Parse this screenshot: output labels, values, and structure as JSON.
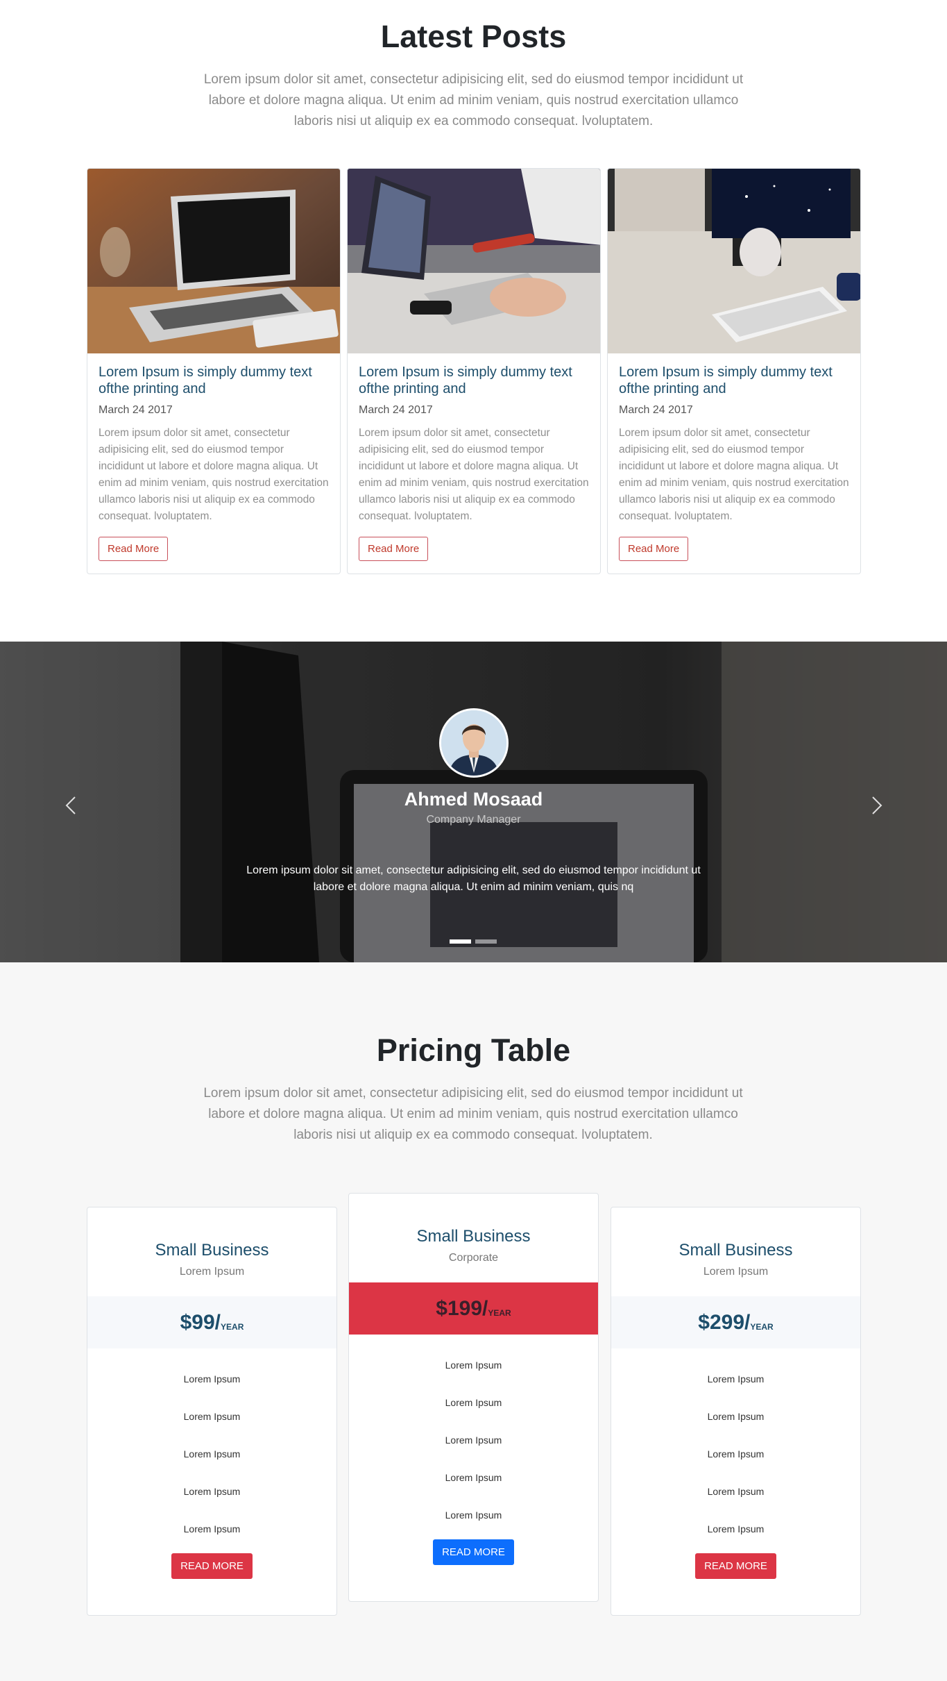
{
  "latest_posts": {
    "title": "Latest Posts",
    "intro": "Lorem ipsum dolor sit amet, consectetur adipisicing elit, sed do eiusmod tempor incididunt ut labore et dolore magna aliqua. Ut enim ad minim veniam, quis nostrud exercitation ullamco laboris nisi ut aliquip ex ea commodo consequat. lvoluptatem.",
    "posts": [
      {
        "image": "laptop-photo",
        "title": "Lorem Ipsum is simply dummy text ofthe printing and",
        "date": "March 24 2017",
        "text": "Lorem ipsum dolor sit amet, consectetur adipisicing elit, sed do eiusmod tempor incididunt ut labore et dolore magna aliqua. Ut enim ad minim veniam, quis nostrud exercitation ullamco laboris nisi ut aliquip ex ea commodo consequat. lvoluptatem.",
        "button": "Read More"
      },
      {
        "image": "desk-laptops-photo",
        "title": "Lorem Ipsum is simply dummy text ofthe printing and",
        "date": "March 24 2017",
        "text": "Lorem ipsum dolor sit amet, consectetur adipisicing elit, sed do eiusmod tempor incididunt ut labore et dolore magna aliqua. Ut enim ad minim veniam, quis nostrud exercitation ullamco laboris nisi ut aliquip ex ea commodo consequat. lvoluptatem.",
        "button": "Read More"
      },
      {
        "image": "workstation-photo",
        "title": "Lorem Ipsum is simply dummy text ofthe printing and",
        "date": "March 24 2017",
        "text": "Lorem ipsum dolor sit amet, consectetur adipisicing elit, sed do eiusmod tempor incididunt ut labore et dolore magna aliqua. Ut enim ad minim veniam, quis nostrud exercitation ullamco laboris nisi ut aliquip ex ea commodo consequat. lvoluptatem.",
        "button": "Read More"
      }
    ]
  },
  "testimonial": {
    "name": "Ahmed Mosaad",
    "role": "Company Manager",
    "quote": "Lorem ipsum dolor sit amet, consectetur adipisicing elit, sed do eiusmod tempor incididunt ut labore et dolore magna aliqua. Ut enim ad minim veniam, quis nq",
    "prev_icon": "chevron-left-icon",
    "next_icon": "chevron-right-icon",
    "slides_count": 2,
    "active_slide": 1
  },
  "pricing": {
    "title": "Pricing Table",
    "intro": "Lorem ipsum dolor sit amet, consectetur adipisicing elit, sed do eiusmod tempor incididunt ut labore et dolore magna aliqua. Ut enim ad minim veniam, quis nostrud exercitation ullamco laboris nisi ut aliquip ex ea commodo consequat. lvoluptatem.",
    "plans": [
      {
        "title": "Small Business",
        "subtitle": "Lorem Ipsum",
        "price": "$99/",
        "period": "YEAR",
        "features": [
          "Lorem Ipsum",
          "Lorem Ipsum",
          "Lorem Ipsum",
          "Lorem Ipsum",
          "Lorem Ipsum"
        ],
        "button": "READ MORE"
      },
      {
        "title": "Small Business",
        "subtitle": "Corporate",
        "price": "$199/",
        "period": "YEAR",
        "features": [
          "Lorem Ipsum",
          "Lorem Ipsum",
          "Lorem Ipsum",
          "Lorem Ipsum",
          "Lorem Ipsum"
        ],
        "button": "READ MORE"
      },
      {
        "title": "Small Business",
        "subtitle": "Lorem Ipsum",
        "price": "$299/",
        "period": "YEAR",
        "features": [
          "Lorem Ipsum",
          "Lorem Ipsum",
          "Lorem Ipsum",
          "Lorem Ipsum",
          "Lorem Ipsum"
        ],
        "button": "READ MORE"
      }
    ]
  },
  "colors": {
    "heading": "#212529",
    "card_title": "#1d4e6b",
    "accent_red": "#dc3545",
    "accent_blue": "#0d6efd",
    "muted_text": "#8a8a8a"
  }
}
